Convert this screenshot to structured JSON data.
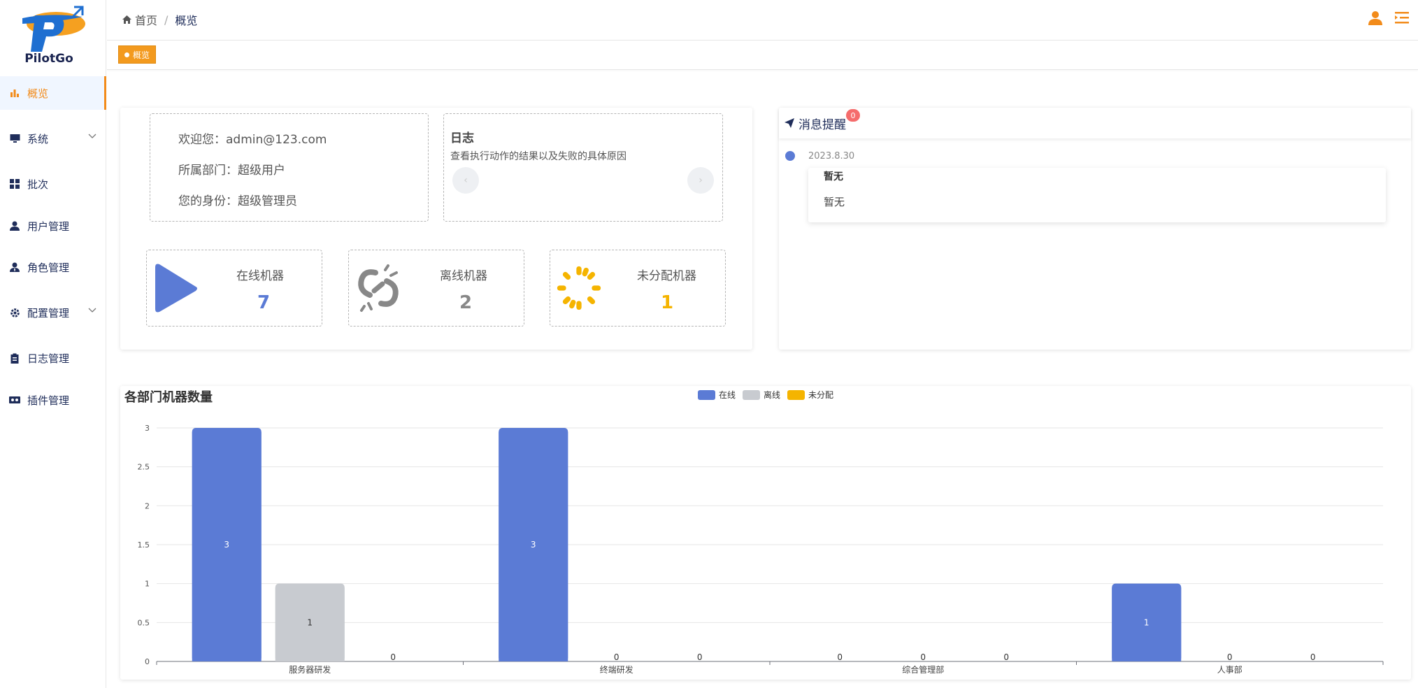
{
  "app": {
    "name": "PilotGo"
  },
  "sidebar": {
    "items": [
      {
        "label": "概览",
        "icon": "bar-chart-icon",
        "active": true
      },
      {
        "label": "系统",
        "icon": "monitor-icon",
        "expandable": true
      },
      {
        "label": "批次",
        "icon": "grid-icon"
      },
      {
        "label": "用户管理",
        "icon": "user-icon"
      },
      {
        "label": "角色管理",
        "icon": "role-icon"
      },
      {
        "label": "配置管理",
        "icon": "gear-icon",
        "expandable": true
      },
      {
        "label": "日志管理",
        "icon": "clipboard-icon"
      },
      {
        "label": "插件管理",
        "icon": "plugin-icon"
      }
    ]
  },
  "header": {
    "breadcrumb_home": "首页",
    "breadcrumb_sep": "/",
    "breadcrumb_current": "概览"
  },
  "tags": {
    "active_tag": "概览"
  },
  "welcome": {
    "line1": "欢迎您：admin@123.com",
    "line2": "所属部门：超级用户",
    "line3": "您的身份：超级管理员"
  },
  "log": {
    "title": "日志",
    "desc": "查看执行动作的结果以及失败的具体原因",
    "prev": "‹",
    "next": "›"
  },
  "stats": [
    {
      "label": "在线机器",
      "value": "7",
      "color": "#5b7bd5"
    },
    {
      "label": "离线机器",
      "value": "2",
      "color": "#888888"
    },
    {
      "label": "未分配机器",
      "value": "1",
      "color": "#f5b400"
    }
  ],
  "notice": {
    "title": "消息提醒",
    "badge": "0",
    "date": "2023.8.30",
    "card_title": "暂无",
    "card_body": "暂无"
  },
  "colors": {
    "online": "#5b7bd5",
    "offline": "#c8cbd0",
    "unassigned": "#f5b400",
    "accent": "#f28b1a"
  },
  "chart_data": {
    "type": "bar",
    "title": "各部门机器数量",
    "categories": [
      "服务器研发",
      "终端研发",
      "综合管理部",
      "人事部"
    ],
    "series": [
      {
        "name": "在线",
        "values": [
          3,
          3,
          0,
          1
        ]
      },
      {
        "name": "离线",
        "values": [
          1,
          0,
          0,
          0
        ]
      },
      {
        "name": "未分配",
        "values": [
          0,
          0,
          0,
          0
        ]
      }
    ],
    "ylim": [
      0,
      3
    ],
    "yticks": [
      "0",
      "0.5",
      "1",
      "1.5",
      "2",
      "2.5",
      "3"
    ],
    "legend_position": "top-center",
    "grid": true
  }
}
